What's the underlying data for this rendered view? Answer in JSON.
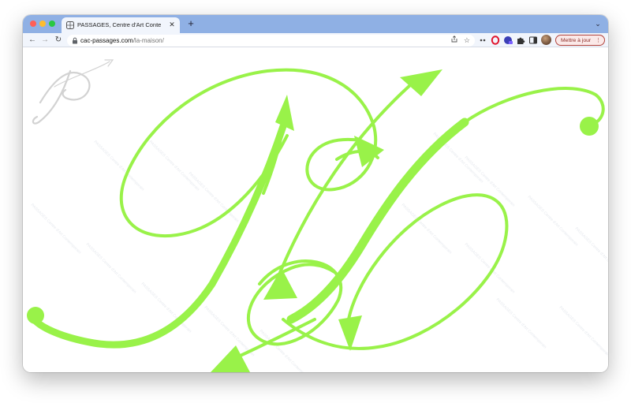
{
  "browser": {
    "tab": {
      "title": "PASSAGES, Centre d'Art Conte",
      "close": "✕",
      "favicon": "grid-favicon-icon"
    },
    "new_tab_symbol": "+",
    "tabs_menu_symbol": "⌄",
    "nav": {
      "back": "←",
      "forward": "→",
      "reload": "↻"
    },
    "address": {
      "host": "cac-passages.com",
      "path": "/la-maison/",
      "lock": "lock-icon",
      "share": "share-icon",
      "star": "☆"
    },
    "extensions": [
      "more-dots-icon",
      "opera-icon",
      "spy-extension-icon",
      "puzzle-icon",
      "side-panel-icon"
    ],
    "update_button": {
      "label": "Mettre à jour",
      "more": "⋮"
    }
  },
  "page": {
    "accent_color": "#99f249",
    "logo_color": "#d2d2d2",
    "watermark_text": "PASSAGES Centre d'Art Contemporain"
  }
}
